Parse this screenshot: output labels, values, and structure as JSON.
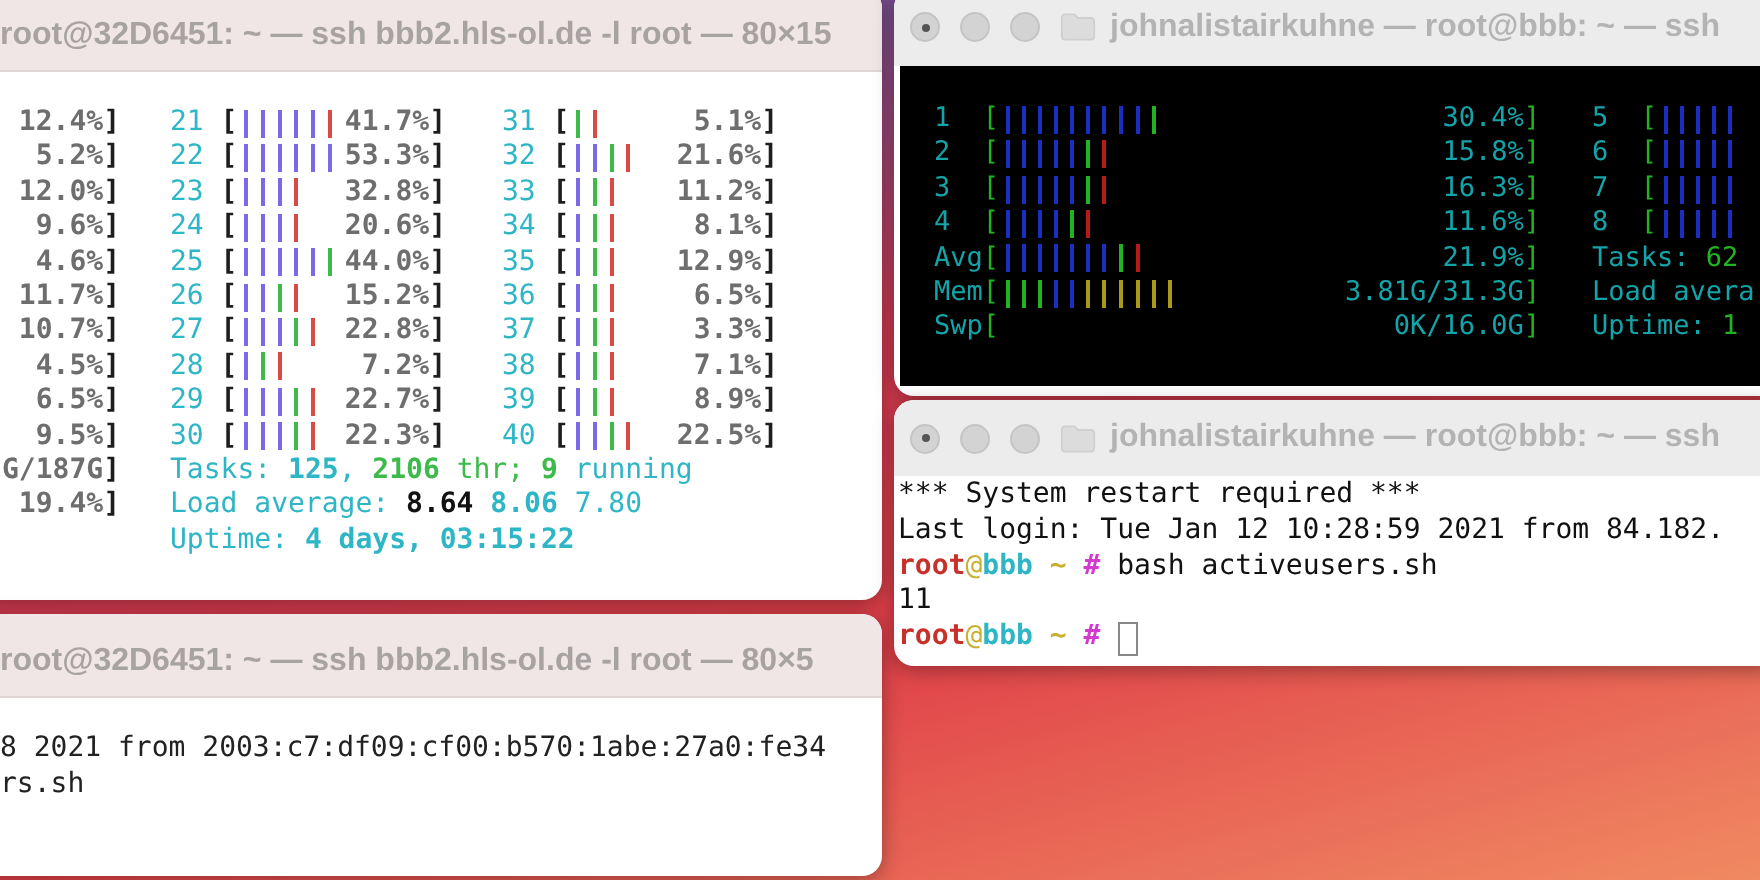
{
  "htop_window": {
    "title": "root@32D6451: ~ — ssh bbb2.hls-ol.de -l root — 80×15",
    "left_column": [
      {
        "value": "12.4%",
        "close": "]"
      },
      {
        "value": "5.2%",
        "close": "]"
      },
      {
        "value": "12.0%",
        "close": "]"
      },
      {
        "value": "9.6%",
        "close": "]"
      },
      {
        "value": "4.6%",
        "close": "]"
      },
      {
        "value": "11.7%",
        "close": "]"
      },
      {
        "value": "10.7%",
        "close": "]"
      },
      {
        "value": "4.5%",
        "close": "]"
      },
      {
        "value": "6.5%",
        "close": "]"
      },
      {
        "value": "9.5%",
        "close": "]"
      },
      {
        "value": "G/187G",
        "close": "]"
      },
      {
        "value": "19.4%",
        "close": "]"
      }
    ],
    "cpu_rows": [
      {
        "id": "21",
        "open": "[",
        "bars": [
          {
            "kind": "user"
          },
          {
            "kind": "user"
          },
          {
            "kind": "user"
          },
          {
            "kind": "user"
          },
          {
            "kind": "user"
          },
          {
            "kind": "kernel"
          }
        ],
        "value": "41.7%",
        "close": "]"
      },
      {
        "id": "22",
        "open": "[",
        "bars": [
          {
            "kind": "user"
          },
          {
            "kind": "user"
          },
          {
            "kind": "user"
          },
          {
            "kind": "user"
          },
          {
            "kind": "user"
          },
          {
            "kind": "user"
          }
        ],
        "value": "53.3%",
        "close": "]"
      },
      {
        "id": "23",
        "open": "[",
        "bars": [
          {
            "kind": "user"
          },
          {
            "kind": "user"
          },
          {
            "kind": "user"
          },
          {
            "kind": "kernel"
          }
        ],
        "value": "32.8%",
        "close": "]"
      },
      {
        "id": "24",
        "open": "[",
        "bars": [
          {
            "kind": "user"
          },
          {
            "kind": "user"
          },
          {
            "kind": "user"
          },
          {
            "kind": "kernel"
          }
        ],
        "value": "20.6%",
        "close": "]"
      },
      {
        "id": "25",
        "open": "[",
        "bars": [
          {
            "kind": "user"
          },
          {
            "kind": "user"
          },
          {
            "kind": "user"
          },
          {
            "kind": "user"
          },
          {
            "kind": "user"
          },
          {
            "kind": "nice"
          }
        ],
        "value": "44.0%",
        "close": "]"
      },
      {
        "id": "26",
        "open": "[",
        "bars": [
          {
            "kind": "user"
          },
          {
            "kind": "user"
          },
          {
            "kind": "nice"
          },
          {
            "kind": "kernel"
          }
        ],
        "value": "15.2%",
        "close": "]"
      },
      {
        "id": "27",
        "open": "[",
        "bars": [
          {
            "kind": "user"
          },
          {
            "kind": "user"
          },
          {
            "kind": "user"
          },
          {
            "kind": "nice"
          },
          {
            "kind": "kernel"
          }
        ],
        "value": "22.8%",
        "close": "]"
      },
      {
        "id": "28",
        "open": "[",
        "bars": [
          {
            "kind": "user"
          },
          {
            "kind": "nice"
          },
          {
            "kind": "kernel"
          }
        ],
        "value": "7.2%",
        "close": "]"
      },
      {
        "id": "29",
        "open": "[",
        "bars": [
          {
            "kind": "user"
          },
          {
            "kind": "user"
          },
          {
            "kind": "user"
          },
          {
            "kind": "nice"
          },
          {
            "kind": "kernel"
          }
        ],
        "value": "22.7%",
        "close": "]"
      },
      {
        "id": "30",
        "open": "[",
        "bars": [
          {
            "kind": "user"
          },
          {
            "kind": "user"
          },
          {
            "kind": "user"
          },
          {
            "kind": "nice"
          },
          {
            "kind": "kernel"
          }
        ],
        "value": "22.3%",
        "close": "]"
      }
    ],
    "cpu_rows_2": [
      {
        "id": "31",
        "open": "[",
        "bars": [
          {
            "kind": "nice"
          },
          {
            "kind": "kernel"
          }
        ],
        "value": "5.1%",
        "close": "]"
      },
      {
        "id": "32",
        "open": "[",
        "bars": [
          {
            "kind": "user"
          },
          {
            "kind": "user"
          },
          {
            "kind": "nice"
          },
          {
            "kind": "kernel"
          }
        ],
        "value": "21.6%",
        "close": "]"
      },
      {
        "id": "33",
        "open": "[",
        "bars": [
          {
            "kind": "user"
          },
          {
            "kind": "nice"
          },
          {
            "kind": "kernel"
          }
        ],
        "value": "11.2%",
        "close": "]"
      },
      {
        "id": "34",
        "open": "[",
        "bars": [
          {
            "kind": "user"
          },
          {
            "kind": "nice"
          },
          {
            "kind": "kernel"
          }
        ],
        "value": "8.1%",
        "close": "]"
      },
      {
        "id": "35",
        "open": "[",
        "bars": [
          {
            "kind": "user"
          },
          {
            "kind": "nice"
          },
          {
            "kind": "kernel"
          }
        ],
        "value": "12.9%",
        "close": "]"
      },
      {
        "id": "36",
        "open": "[",
        "bars": [
          {
            "kind": "user"
          },
          {
            "kind": "nice"
          },
          {
            "kind": "kernel"
          }
        ],
        "value": "6.5%",
        "close": "]"
      },
      {
        "id": "37",
        "open": "[",
        "bars": [
          {
            "kind": "user"
          },
          {
            "kind": "nice"
          },
          {
            "kind": "kernel"
          }
        ],
        "value": "3.3%",
        "close": "]"
      },
      {
        "id": "38",
        "open": "[",
        "bars": [
          {
            "kind": "user"
          },
          {
            "kind": "nice"
          },
          {
            "kind": "kernel"
          }
        ],
        "value": "7.1%",
        "close": "]"
      },
      {
        "id": "39",
        "open": "[",
        "bars": [
          {
            "kind": "user"
          },
          {
            "kind": "nice"
          },
          {
            "kind": "kernel"
          }
        ],
        "value": "8.9%",
        "close": "]"
      },
      {
        "id": "40",
        "open": "[",
        "bars": [
          {
            "kind": "user"
          },
          {
            "kind": "user"
          },
          {
            "kind": "nice"
          },
          {
            "kind": "kernel"
          }
        ],
        "value": "22.5%",
        "close": "]"
      }
    ],
    "summary": [
      {
        "parts": [
          {
            "text": "Tasks: ",
            "kind": "label"
          },
          {
            "text": "125",
            "kind": "value"
          },
          {
            "text": ", ",
            "kind": "label"
          },
          {
            "text": "2106",
            "kind": "highlight"
          },
          {
            "text": " thr; ",
            "kind": "note"
          },
          {
            "text": "9",
            "kind": "highlight"
          },
          {
            "text": " running",
            "kind": "label"
          }
        ]
      },
      {
        "parts": [
          {
            "text": "Load average: ",
            "kind": "label"
          },
          {
            "text": "8.64 ",
            "kind": "accent"
          },
          {
            "text": "8.06",
            "kind": "value"
          },
          {
            "text": " 7.80",
            "kind": "label"
          }
        ]
      },
      {
        "parts": [
          {
            "text": "Uptime: ",
            "kind": "label"
          },
          {
            "text": "4 days, 03:15:22",
            "kind": "value"
          }
        ]
      }
    ]
  },
  "monitor_window": {
    "title": "johnalistairkuhne — root@bbb: ~ — ssh",
    "meters": [
      {
        "id": "1",
        "open": "[",
        "bars": [
          {
            "kind": "user"
          },
          {
            "kind": "user"
          },
          {
            "kind": "user"
          },
          {
            "kind": "user"
          },
          {
            "kind": "user"
          },
          {
            "kind": "user"
          },
          {
            "kind": "user"
          },
          {
            "kind": "user"
          },
          {
            "kind": "user"
          },
          {
            "kind": "nice"
          }
        ],
        "value": "30.4%",
        "close": "]"
      },
      {
        "id": "2",
        "open": "[",
        "bars": [
          {
            "kind": "user"
          },
          {
            "kind": "user"
          },
          {
            "kind": "user"
          },
          {
            "kind": "user"
          },
          {
            "kind": "user"
          },
          {
            "kind": "nice"
          },
          {
            "kind": "kernel"
          }
        ],
        "value": "15.8%",
        "close": "]"
      },
      {
        "id": "3",
        "open": "[",
        "bars": [
          {
            "kind": "user"
          },
          {
            "kind": "user"
          },
          {
            "kind": "user"
          },
          {
            "kind": "user"
          },
          {
            "kind": "user"
          },
          {
            "kind": "nice"
          },
          {
            "kind": "kernel"
          }
        ],
        "value": "16.3%",
        "close": "]"
      },
      {
        "id": "4",
        "open": "[",
        "bars": [
          {
            "kind": "user"
          },
          {
            "kind": "user"
          },
          {
            "kind": "user"
          },
          {
            "kind": "user"
          },
          {
            "kind": "nice"
          },
          {
            "kind": "kernel"
          }
        ],
        "value": "11.6%",
        "close": "]"
      },
      {
        "id": "Avg",
        "open": "[",
        "bars": [
          {
            "kind": "user"
          },
          {
            "kind": "user"
          },
          {
            "kind": "user"
          },
          {
            "kind": "user"
          },
          {
            "kind": "user"
          },
          {
            "kind": "user"
          },
          {
            "kind": "user"
          },
          {
            "kind": "nice"
          },
          {
            "kind": "kernel"
          }
        ],
        "value": "21.9%",
        "close": "]"
      },
      {
        "id": "Mem",
        "open": "[",
        "bars": [
          {
            "kind": "nice"
          },
          {
            "kind": "nice"
          },
          {
            "kind": "nice"
          },
          {
            "kind": "user"
          },
          {
            "kind": "user"
          },
          {
            "kind": "cache"
          },
          {
            "kind": "cache"
          },
          {
            "kind": "cache"
          },
          {
            "kind": "cache"
          },
          {
            "kind": "cache"
          },
          {
            "kind": "cache"
          }
        ],
        "value": "3.81G/31.3G",
        "close": "]"
      },
      {
        "id": "Swp",
        "open": "[",
        "value": "0K/16.0G",
        "close": "]"
      }
    ],
    "side": [
      {
        "kind": "meter",
        "id": "5",
        "open": "[",
        "bars": [
          {
            "kind": "user"
          },
          {
            "kind": "user"
          },
          {
            "kind": "user"
          },
          {
            "kind": "user"
          },
          {
            "kind": "user"
          }
        ]
      },
      {
        "kind": "meter",
        "id": "6",
        "open": "[",
        "bars": [
          {
            "kind": "user"
          },
          {
            "kind": "user"
          },
          {
            "kind": "user"
          },
          {
            "kind": "user"
          },
          {
            "kind": "user"
          }
        ]
      },
      {
        "kind": "meter",
        "id": "7",
        "open": "[",
        "bars": [
          {
            "kind": "user"
          },
          {
            "kind": "user"
          },
          {
            "kind": "user"
          },
          {
            "kind": "user"
          },
          {
            "kind": "user"
          }
        ]
      },
      {
        "kind": "meter",
        "id": "8",
        "open": "[",
        "bars": [
          {
            "kind": "user"
          },
          {
            "kind": "user"
          },
          {
            "kind": "user"
          },
          {
            "kind": "user"
          },
          {
            "kind": "user"
          }
        ]
      },
      {
        "kind": "line",
        "parts": [
          {
            "text": "Tasks: ",
            "kind": "label"
          },
          {
            "text": "62",
            "kind": "highlight"
          }
        ]
      },
      {
        "kind": "line",
        "parts": [
          {
            "text": "Load avera",
            "kind": "label"
          }
        ]
      },
      {
        "kind": "line",
        "parts": [
          {
            "text": "Uptime: ",
            "kind": "label"
          },
          {
            "text": "1",
            "kind": "highlight"
          }
        ]
      }
    ]
  },
  "login_window": {
    "title": "johnalistairkuhne — root@bbb: ~ — ssh",
    "lines": [
      {
        "parts": [
          {
            "text": "*** System restart required ***",
            "kind": "plain"
          }
        ],
        "cursor": false
      },
      {
        "parts": [
          {
            "text": "Last login: Tue Jan 12 10:28:59 2021 from 84.182.",
            "kind": "plain"
          }
        ],
        "cursor": false
      },
      {
        "parts": [
          {
            "text": "root",
            "kind": "user"
          },
          {
            "text": "@",
            "kind": "at"
          },
          {
            "text": "bbb",
            "kind": "host"
          },
          {
            "text": " ~ ",
            "kind": "path"
          },
          {
            "text": "#",
            "kind": "sign"
          },
          {
            "text": " bash activeusers.sh",
            "kind": "plain"
          }
        ],
        "cursor": false
      },
      {
        "parts": [
          {
            "text": "11",
            "kind": "plain"
          }
        ],
        "cursor": false
      },
      {
        "parts": [
          {
            "text": "root",
            "kind": "user"
          },
          {
            "text": "@",
            "kind": "at"
          },
          {
            "text": "bbb",
            "kind": "host"
          },
          {
            "text": " ~ ",
            "kind": "path"
          },
          {
            "text": "#",
            "kind": "sign"
          }
        ],
        "cursor": true
      }
    ]
  },
  "session_window": {
    "title": "root@32D6451: ~ — ssh bbb2.hls-ol.de -l root — 80×5",
    "lines": [
      "8 2021 from 2003:c7:df09:cf00:b570:1abe:27a0:fe34",
      "rs.sh"
    ]
  }
}
